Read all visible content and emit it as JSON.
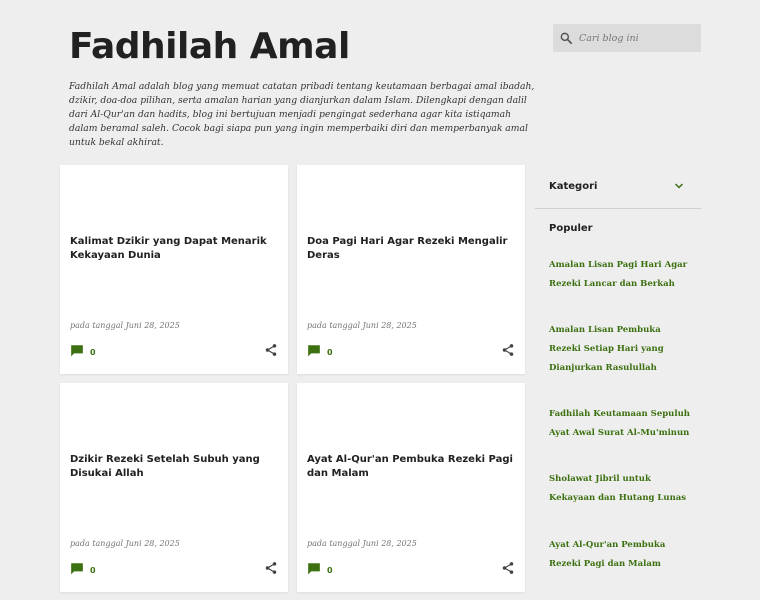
{
  "header": {
    "title": "Fadhilah Amal",
    "description": "Fadhilah Amal adalah blog yang memuat catatan pribadi tentang keutamaan berbagai amal ibadah, dzikir, doa-doa pilihan, serta amalan harian yang dianjurkan dalam Islam. Dilengkapi dengan dalil dari Al-Qur'an dan hadits, blog ini bertujuan menjadi pengingat sederhana agar kita istiqamah dalam beramal saleh. Cocok bagi siapa pun yang ingin memperbaiki diri dan memperbanyak amal untuk bekal akhirat."
  },
  "search": {
    "placeholder": "Cari blog ini",
    "value": ""
  },
  "posts": [
    {
      "title": "Kalimat Dzikir yang Dapat Menarik Kekayaan Dunia",
      "date": "pada tanggal Juni 28, 2025",
      "comments": "0"
    },
    {
      "title": "Doa Pagi Hari Agar Rezeki Mengalir Deras",
      "date": "pada tanggal Juni 28, 2025",
      "comments": "0"
    },
    {
      "title": "Dzikir Rezeki Setelah Subuh yang Disukai Allah",
      "date": "pada tanggal Juni 28, 2025",
      "comments": "0"
    },
    {
      "title": "Ayat Al-Qur'an Pembuka Rezeki Pagi dan Malam",
      "date": "pada tanggal Juni 28, 2025",
      "comments": "0"
    }
  ],
  "sidebar": {
    "categories_label": "Kategori",
    "popular_heading": "Populer",
    "popular": [
      "Amalan Lisan Pagi Hari Agar Rezeki Lancar dan Berkah",
      "Amalan Lisan Pembuka Rezeki Setiap Hari yang Dianjurkan Rasulullah",
      "Fadhilah Keutamaan Sepuluh Ayat Awal Surat Al-Mu'minun",
      "Sholawat Jibril untuk Kekayaan dan Hutang Lunas",
      "Ayat Al-Qur'an Pembuka Rezeki Pagi dan Malam"
    ]
  },
  "colors": {
    "accent": "#3c7010",
    "background": "#eeeeee",
    "card": "#ffffff"
  },
  "icons": {
    "search": "search-icon",
    "comment": "comment-icon",
    "share": "share-icon",
    "expand": "chevron-down-icon"
  }
}
